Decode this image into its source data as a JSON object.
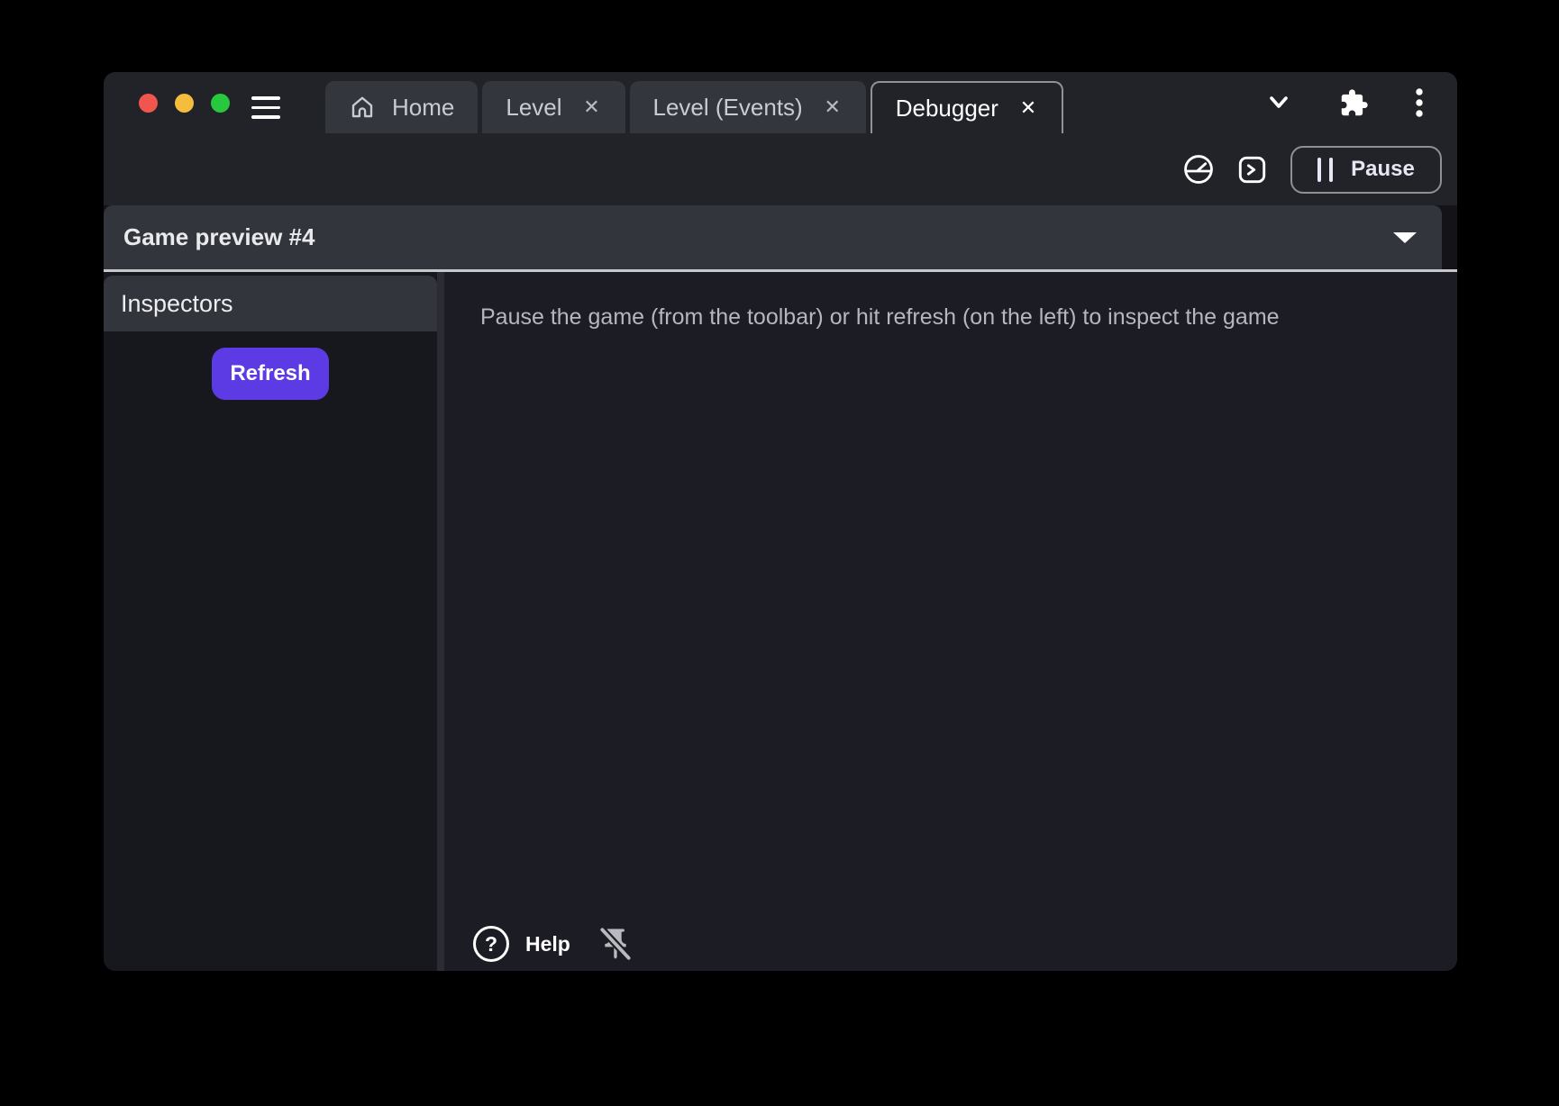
{
  "titlebar": {
    "tabs": [
      {
        "label": "Home"
      },
      {
        "label": "Level"
      },
      {
        "label": "Level (Events)"
      },
      {
        "label": "Debugger"
      }
    ]
  },
  "toolbar": {
    "pause_label": "Pause"
  },
  "preview_bar": {
    "title": "Game preview #4"
  },
  "sidebar": {
    "header": "Inspectors",
    "refresh_label": "Refresh"
  },
  "main": {
    "message": "Pause the game (from the toolbar) or hit refresh (on the left) to inspect the game",
    "help_label": "Help"
  },
  "icons": {
    "close": "✕",
    "help_glyph": "?"
  },
  "colors": {
    "accent_purple": "#5d3be4",
    "window_chrome": "#222329",
    "panel_light": "#33353c",
    "sidebar_bg": "#17181e",
    "main_bg": "#1c1d24",
    "traffic_red": "#f1564e",
    "traffic_yellow": "#f5bd3e",
    "traffic_green": "#27c83e"
  }
}
